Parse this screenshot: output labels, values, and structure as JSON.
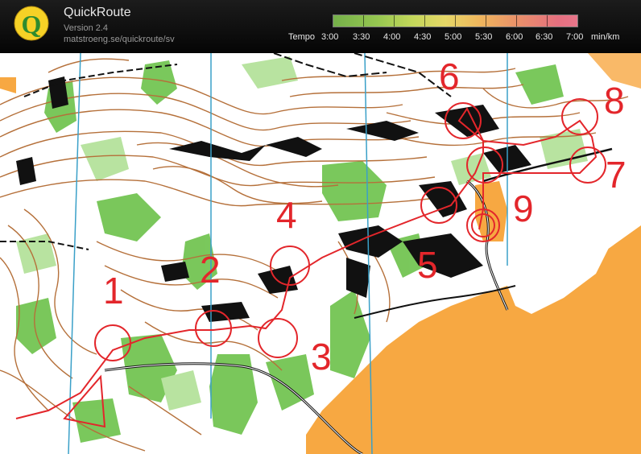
{
  "app": {
    "name": "QuickRoute",
    "version": "Version 2.4",
    "url": "matstroeng.se/quickroute/sv",
    "logo_letter": "Q"
  },
  "tempo_scale": {
    "title": "Tempo",
    "labels": [
      "3:00",
      "3:30",
      "4:00",
      "4:30",
      "5:00",
      "5:30",
      "6:00",
      "6:30",
      "7:00"
    ],
    "unit": "min/km",
    "colors": [
      "#75b04a",
      "#95c650",
      "#c2d75a",
      "#e6d767",
      "#efb65d",
      "#e98f6a",
      "#e5707f",
      "#e7758a"
    ]
  },
  "map": {
    "controls": [
      "1",
      "2",
      "3",
      "4",
      "5",
      "6",
      "7",
      "8",
      "9"
    ],
    "course_color": "#e3262b",
    "contour_color": "#b5703a",
    "vegetation_color": "#6cc24a",
    "open_land_color": "#f7a842",
    "magnetic_north_color": "#3aa0c8"
  }
}
